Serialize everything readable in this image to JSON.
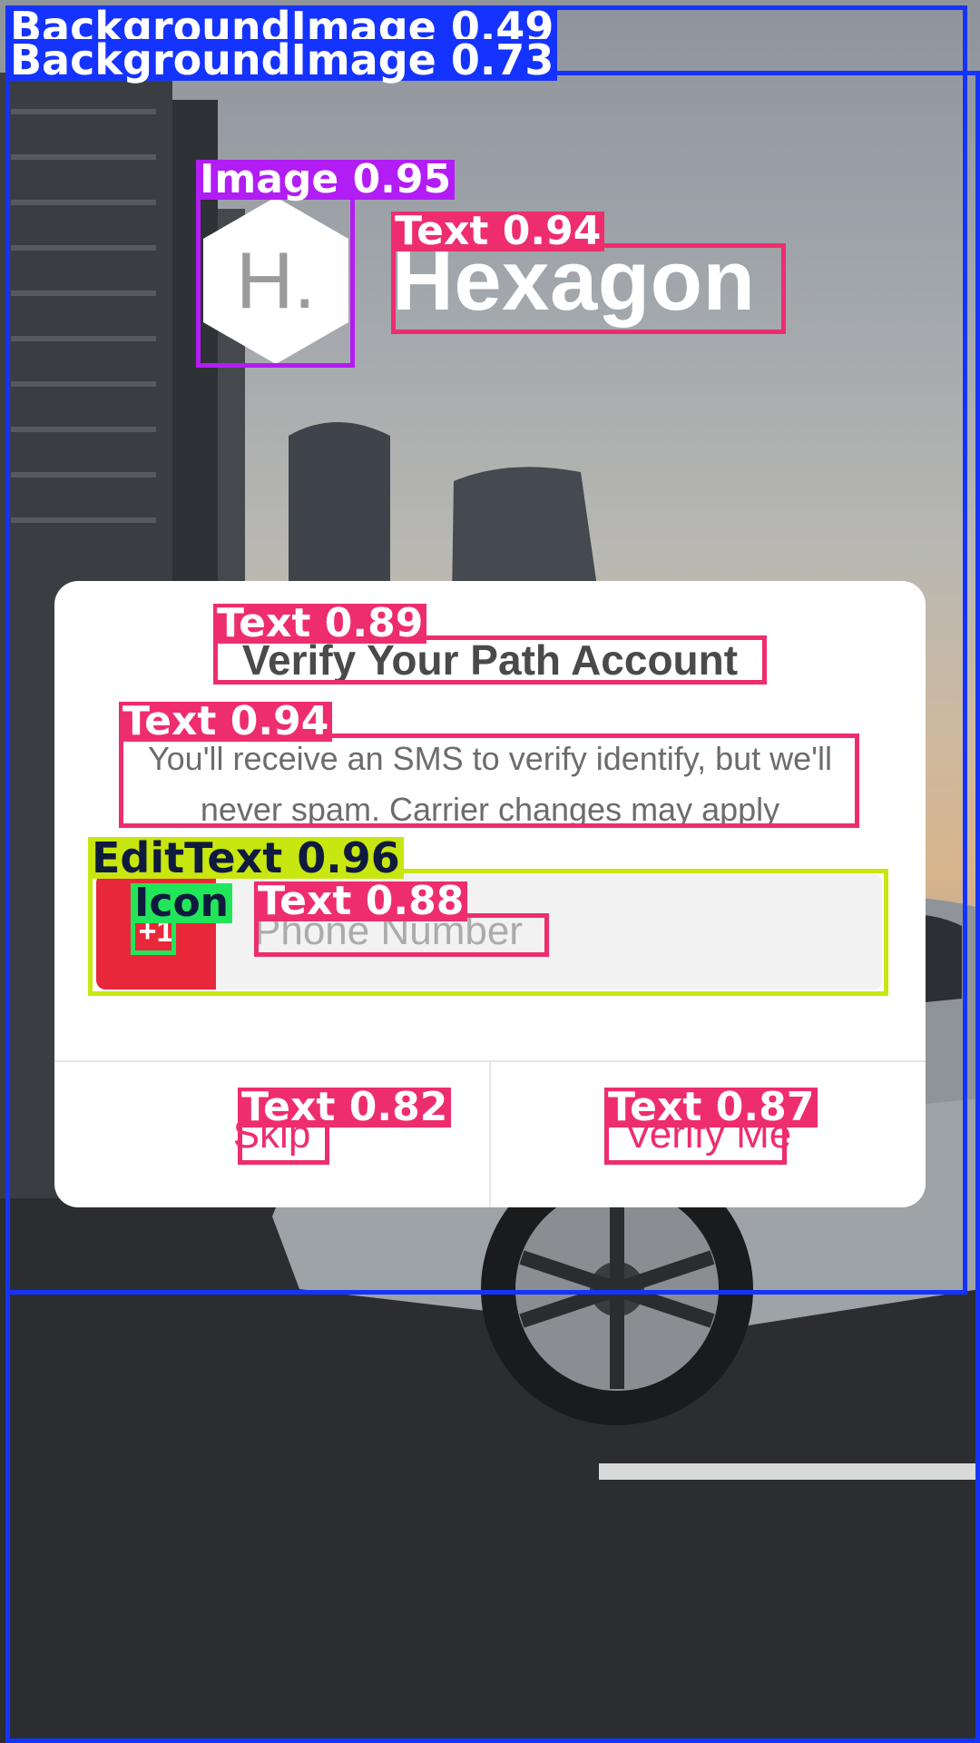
{
  "app": {
    "brand_name": "Hexagon",
    "logo_letter": "H."
  },
  "dialog": {
    "title": "Verify Your Path Account",
    "message": "You'll receive an SMS to verify identify, but we'll never spam. Carrier changes may apply",
    "country_code": "+1",
    "phone_placeholder": "Phone Number",
    "skip_label": "Skip",
    "verify_label": "Verify Me"
  },
  "detections": {
    "background_1": "BackgroundImage 0.49",
    "background_2": "BackgroundImage 0.73",
    "logo_image": "Image 0.95",
    "brand_text": "Text 0.94",
    "title_text": "Text 0.89",
    "message_text": "Text 0.94",
    "phone_edittext": "EditText 0.96",
    "country_icon": "Icon",
    "placeholder_text": "Text 0.88",
    "skip_text": "Text 0.82",
    "verify_text": "Text 0.87"
  },
  "colors": {
    "accent": "#ee2d6e",
    "country_chip": "#e8283a",
    "background_box": "#1533ff",
    "image_box": "#b21cf5",
    "edittext_box": "#c8e60f",
    "icon_box": "#22e65a"
  }
}
